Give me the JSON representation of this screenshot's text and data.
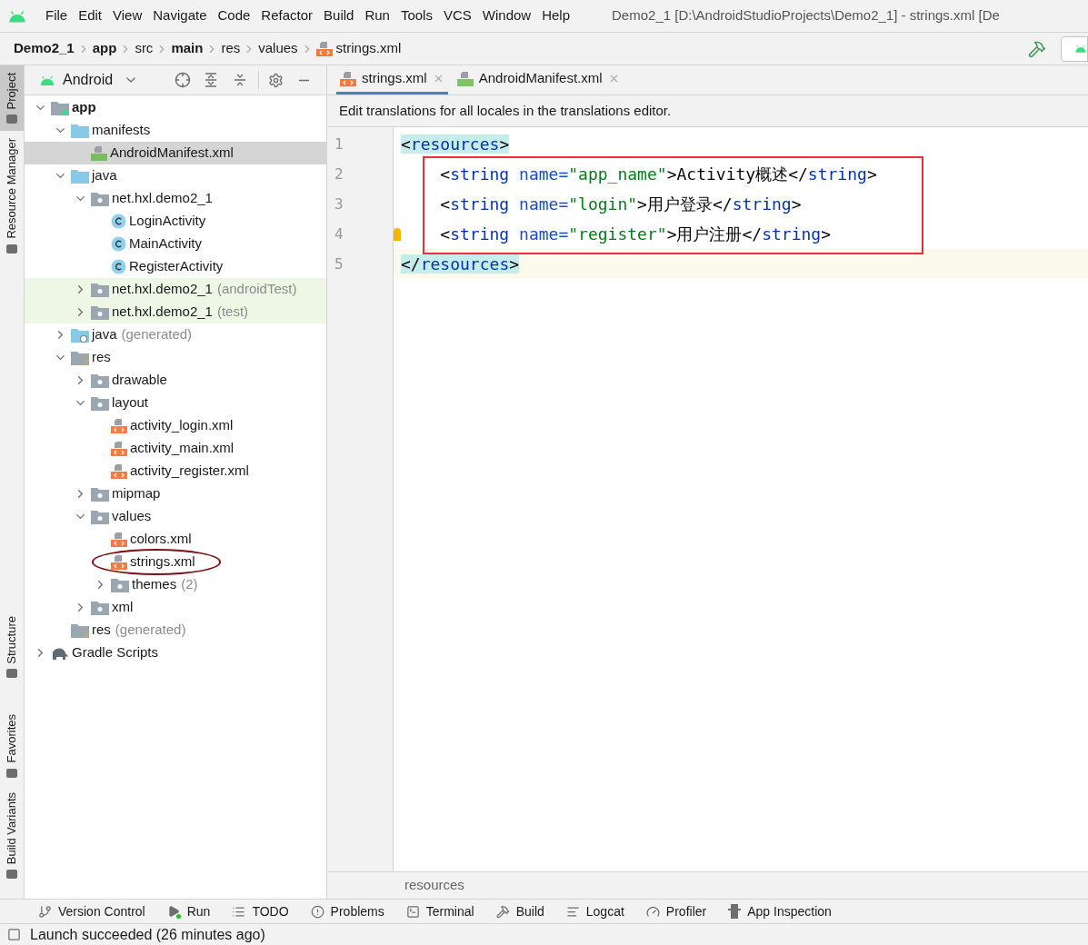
{
  "menu": [
    "File",
    "Edit",
    "View",
    "Navigate",
    "Code",
    "Refactor",
    "Build",
    "Run",
    "Tools",
    "VCS",
    "Window",
    "Help"
  ],
  "window": {
    "title": "Demo2_1 [D:\\AndroidStudioProjects\\Demo2_1] - strings.xml [De"
  },
  "breadcrumb": [
    {
      "label": "Demo2_1",
      "bold": true,
      "kind": "text"
    },
    {
      "label": "app",
      "bold": true,
      "kind": "text"
    },
    {
      "label": "src",
      "bold": false,
      "kind": "text"
    },
    {
      "label": "main",
      "bold": true,
      "kind": "text"
    },
    {
      "label": "res",
      "bold": false,
      "kind": "text"
    },
    {
      "label": "values",
      "bold": false,
      "kind": "text"
    },
    {
      "label": "strings.xml",
      "bold": false,
      "kind": "xml"
    }
  ],
  "side_tools": [
    {
      "label": "Project",
      "selected": true
    },
    {
      "label": "Resource Manager",
      "selected": false
    },
    {
      "label": "Structure",
      "selected": false
    },
    {
      "label": "Favorites",
      "selected": false
    },
    {
      "label": "Build Variants",
      "selected": false
    }
  ],
  "project": {
    "view": "Android",
    "tree": [
      {
        "label": "app",
        "kind": "module",
        "expanded": true,
        "bold": true,
        "selected": false,
        "children": [
          {
            "label": "manifests",
            "kind": "folder",
            "expanded": true,
            "selected": false,
            "children": [
              {
                "label": "AndroidManifest.xml",
                "kind": "manifest",
                "selected": true
              }
            ]
          },
          {
            "label": "java",
            "kind": "folder",
            "expanded": true,
            "selected": false,
            "children": [
              {
                "label": "net.hxl.demo2_1",
                "kind": "package",
                "expanded": true,
                "selected": false,
                "children": [
                  {
                    "label": "LoginActivity",
                    "kind": "class",
                    "selected": false
                  },
                  {
                    "label": "MainActivity",
                    "kind": "class",
                    "selected": false
                  },
                  {
                    "label": "RegisterActivity",
                    "kind": "class",
                    "selected": false
                  }
                ]
              },
              {
                "label": "net.hxl.demo2_1",
                "suffix": "(androidTest)",
                "kind": "package",
                "expanded": false,
                "selected": false,
                "highlighted": true
              },
              {
                "label": "net.hxl.demo2_1",
                "suffix": "(test)",
                "kind": "package",
                "expanded": false,
                "selected": false,
                "highlighted": true
              }
            ]
          },
          {
            "label": "java",
            "suffix": "(generated)",
            "kind": "generated",
            "expanded": false,
            "selected": false
          },
          {
            "label": "res",
            "kind": "res",
            "expanded": true,
            "selected": false,
            "children": [
              {
                "label": "drawable",
                "kind": "package",
                "expanded": false,
                "selected": false
              },
              {
                "label": "layout",
                "kind": "package",
                "expanded": true,
                "selected": false,
                "children": [
                  {
                    "label": "activity_login.xml",
                    "kind": "xml",
                    "selected": false
                  },
                  {
                    "label": "activity_main.xml",
                    "kind": "xml",
                    "selected": false
                  },
                  {
                    "label": "activity_register.xml",
                    "kind": "xml",
                    "selected": false
                  }
                ]
              },
              {
                "label": "mipmap",
                "kind": "package",
                "expanded": false,
                "selected": false
              },
              {
                "label": "values",
                "kind": "package",
                "expanded": true,
                "selected": false,
                "children": [
                  {
                    "label": "colors.xml",
                    "kind": "xml",
                    "selected": false
                  },
                  {
                    "label": "strings.xml",
                    "kind": "xml",
                    "selected": false,
                    "circled": true
                  },
                  {
                    "label": "themes",
                    "suffix": "(2)",
                    "kind": "package",
                    "expanded": false,
                    "selected": false
                  }
                ]
              },
              {
                "label": "xml",
                "kind": "package",
                "expanded": false,
                "selected": false
              }
            ]
          },
          {
            "label": "res",
            "suffix": "(generated)",
            "kind": "res",
            "selected": false
          }
        ]
      },
      {
        "label": "Gradle Scripts",
        "kind": "gradle",
        "expanded": false,
        "selected": false
      }
    ]
  },
  "editor": {
    "tabs": [
      {
        "label": "strings.xml",
        "kind": "xml",
        "selected": true,
        "closable": true
      },
      {
        "label": "AndroidManifest.xml",
        "kind": "manifest",
        "selected": false,
        "closable": true
      }
    ],
    "notice": "Edit translations for all locales in the translations editor.",
    "lines": [
      {
        "number": "1",
        "current": false,
        "tokens": [
          {
            "kind": "punct",
            "text": "<",
            "matched": true
          },
          {
            "kind": "tag",
            "text": "resources",
            "matched": true
          },
          {
            "kind": "punct",
            "text": ">",
            "matched": true
          }
        ]
      },
      {
        "number": "2",
        "current": false,
        "tokens": [
          {
            "kind": "punct",
            "text": "    <",
            "matched": false
          },
          {
            "kind": "tag",
            "text": "string",
            "matched": false
          },
          {
            "kind": "attr",
            "text": " name=",
            "matched": false
          },
          {
            "kind": "value",
            "text": "\"app_name\"",
            "matched": false
          },
          {
            "kind": "punct",
            "text": ">Activity概述</",
            "matched": false
          },
          {
            "kind": "tag",
            "text": "string",
            "matched": false
          },
          {
            "kind": "punct",
            "text": ">",
            "matched": false
          }
        ]
      },
      {
        "number": "3",
        "current": false,
        "tokens": [
          {
            "kind": "punct",
            "text": "    <",
            "matched": false
          },
          {
            "kind": "tag",
            "text": "string",
            "matched": false
          },
          {
            "kind": "attr",
            "text": " name=",
            "matched": false
          },
          {
            "kind": "value",
            "text": "\"login\"",
            "matched": false
          },
          {
            "kind": "punct",
            "text": ">用户登录</",
            "matched": false
          },
          {
            "kind": "tag",
            "text": "string",
            "matched": false
          },
          {
            "kind": "punct",
            "text": ">",
            "matched": false
          }
        ]
      },
      {
        "number": "4",
        "current": false,
        "bulb": true,
        "tokens": [
          {
            "kind": "punct",
            "text": "    <",
            "matched": false
          },
          {
            "kind": "tag",
            "text": "string",
            "matched": false
          },
          {
            "kind": "attr",
            "text": " name=",
            "matched": false
          },
          {
            "kind": "value",
            "text": "\"register\"",
            "matched": false
          },
          {
            "kind": "punct",
            "text": ">用户注册</",
            "matched": false
          },
          {
            "kind": "tag",
            "text": "string",
            "matched": false
          },
          {
            "kind": "punct",
            "text": ">",
            "matched": false
          }
        ]
      },
      {
        "number": "5",
        "current": true,
        "tokens": [
          {
            "kind": "punct",
            "text": "</",
            "matched": true
          },
          {
            "kind": "tag",
            "text": "resources",
            "matched": true
          },
          {
            "kind": "punct",
            "text": ">",
            "matched": true
          }
        ]
      }
    ],
    "breadcrumb": "resources"
  },
  "tool_windows": [
    {
      "label": "Version Control",
      "kind": "vcs"
    },
    {
      "label": "Run",
      "kind": "run"
    },
    {
      "label": "TODO",
      "kind": "todo"
    },
    {
      "label": "Problems",
      "kind": "problems"
    },
    {
      "label": "Terminal",
      "kind": "terminal"
    },
    {
      "label": "Build",
      "kind": "build"
    },
    {
      "label": "Logcat",
      "kind": "logcat"
    },
    {
      "label": "Profiler",
      "kind": "profiler"
    },
    {
      "label": "App Inspection",
      "kind": "inspection"
    }
  ],
  "status_bar": {
    "message": "Launch succeeded (26 minutes ago)"
  }
}
